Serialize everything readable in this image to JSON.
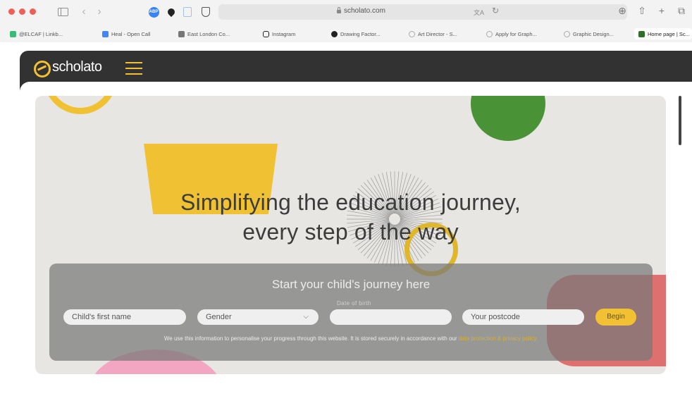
{
  "browser": {
    "url": "scholato.com",
    "favorites": [
      {
        "label": "@ELCAF | Linkb...",
        "color": "#3dba7a"
      },
      {
        "label": "Heal - Open Call",
        "color": "#4285f4"
      },
      {
        "label": "East London Co...",
        "color": "#777777"
      },
      {
        "label": "Instagram",
        "color": "#222222"
      },
      {
        "label": "Drawing Factor...",
        "color": "#222222"
      },
      {
        "label": "Art Director - S...",
        "color": "#aaaaaa"
      },
      {
        "label": "Apply for Graph...",
        "color": "#aaaaaa"
      },
      {
        "label": "Graphic Design...",
        "color": "#aaaaaa"
      },
      {
        "label": "Home page | Sc...",
        "color": "#f2c133"
      }
    ]
  },
  "site": {
    "logo_text": "scholato",
    "headline_line1": "Simplifying the education journey,",
    "headline_line2": "every step of the way",
    "form": {
      "title": "Start your child's journey here",
      "dob_label": "Date of birth",
      "first_name_placeholder": "Child's first name",
      "gender_placeholder": "Gender",
      "dob_placeholder": "",
      "postcode_placeholder": "Your postcode",
      "begin_label": "Begin",
      "privacy_text": "We use this information to personalise your progress through this website. It is stored securely in accordance with our",
      "privacy_link": "data protection & privacy policy."
    }
  },
  "colors": {
    "accent_yellow": "#f2c133",
    "nav_dark": "#333232",
    "hero_bg": "#e7e6e3",
    "green": "#4a9236",
    "red": "#de7170",
    "pink": "#f3a6c2"
  }
}
